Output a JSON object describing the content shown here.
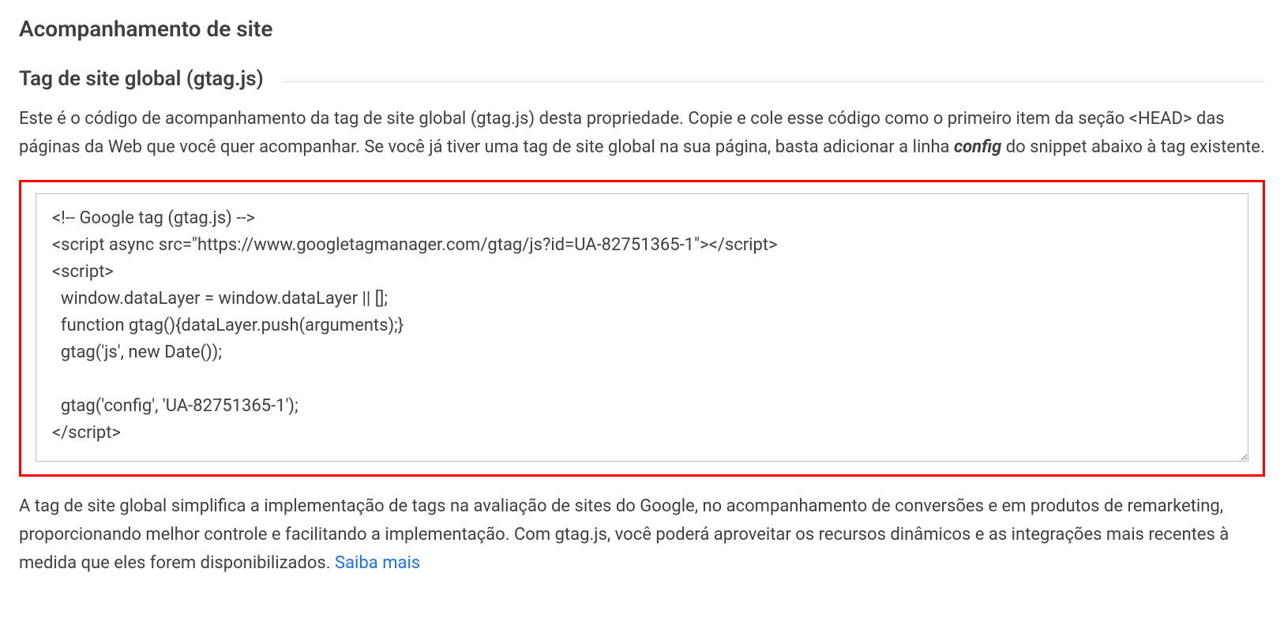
{
  "heading": "Acompanhamento de site",
  "subHeading": "Tag de site global (gtag.js)",
  "descriptionPart1": "Este é o código de acompanhamento da tag de site global (gtag.js) desta propriedade. Copie e cole esse código como o primeiro item da seção <HEAD> das páginas da Web que você quer acompanhar. Se você já tiver uma tag de site global na sua página, basta adicionar a linha ",
  "descriptionBold": "config",
  "descriptionPart2": " do snippet abaixo à tag existente.",
  "codeSnippet": "<!-- Google tag (gtag.js) -->\n<script async src=\"https://www.googletagmanager.com/gtag/js?id=UA-82751365-1\"></script>\n<script>\n  window.dataLayer = window.dataLayer || [];\n  function gtag(){dataLayer.push(arguments);}\n  gtag('js', new Date());\n\n  gtag('config', 'UA-82751365-1');\n</script>",
  "footerText": "A tag de site global simplifica a implementação de tags na avaliação de sites do Google, no acompanhamento de conversões e em produtos de remarketing, proporcionando melhor controle e facilitando a implementação. Com gtag.js, você poderá aproveitar os recursos dinâmicos e as integrações mais recentes à medida que eles forem disponibilizados. ",
  "learnMore": "Saiba mais"
}
